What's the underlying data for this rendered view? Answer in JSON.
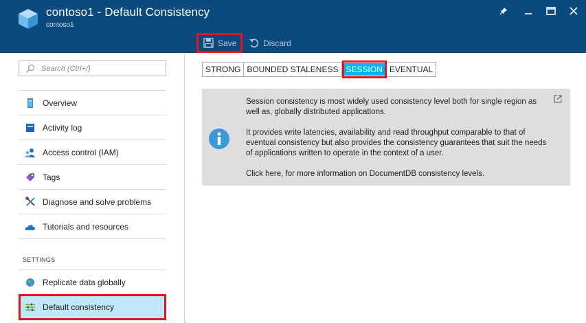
{
  "window": {
    "title": "contoso1 - Default Consistency",
    "subtitle": "contoso1"
  },
  "toolbar": {
    "save_label": "Save",
    "discard_label": "Discard"
  },
  "sidebar": {
    "search_placeholder": "Search (Ctrl+/)",
    "items": [
      {
        "label": "Overview",
        "icon": "overview-icon"
      },
      {
        "label": "Activity log",
        "icon": "activity-log-icon"
      },
      {
        "label": "Access control (IAM)",
        "icon": "iam-icon"
      },
      {
        "label": "Tags",
        "icon": "tag-icon"
      },
      {
        "label": "Diagnose and solve problems",
        "icon": "wrench-icon"
      },
      {
        "label": "Tutorials and resources",
        "icon": "cloud-icon"
      }
    ],
    "settings_label": "SETTINGS",
    "settings_items": [
      {
        "label": "Replicate data globally",
        "icon": "globe-icon"
      },
      {
        "label": "Default consistency",
        "icon": "sliders-icon",
        "selected": true
      }
    ]
  },
  "consistency": {
    "options": [
      "STRONG",
      "BOUNDED STALENESS",
      "SESSION",
      "EVENTUAL"
    ],
    "selected": "SESSION"
  },
  "info": {
    "paragraph1": "Session consistency is most widely used consistency level both for single region as well as, globally distributed applications.",
    "paragraph2": "It provides write latencies, availability and read throughput comparable to that of eventual consistency but also provides the consistency guarantees that suit the needs of applications written to operate in the context of a user.",
    "paragraph3": "Click here, for more information on DocumentDB consistency levels."
  },
  "colors": {
    "header_bg": "#0a4a7e",
    "accent": "#00b4f0",
    "highlight_border": "#e0141e",
    "selected_bg": "#bfe7f7"
  }
}
